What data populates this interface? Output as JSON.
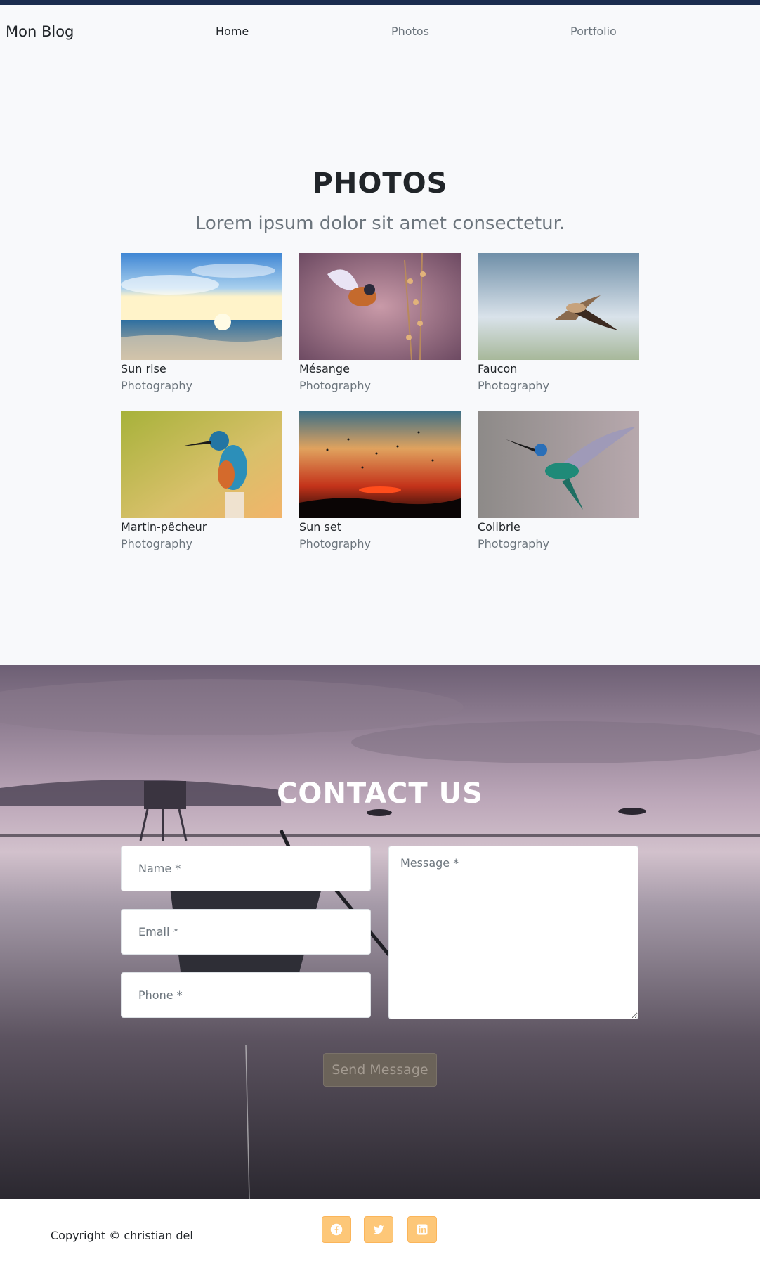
{
  "nav": {
    "brand": "Mon Blog",
    "links": [
      {
        "label": "Home",
        "active": true
      },
      {
        "label": "Photos",
        "active": false
      },
      {
        "label": "Portfolio",
        "active": false
      }
    ]
  },
  "photos": {
    "title": "PHOTOS",
    "subtitle": "Lorem ipsum dolor sit amet consectetur.",
    "items": [
      {
        "title": "Sun rise",
        "category": "Photography"
      },
      {
        "title": "Mésange",
        "category": "Photography"
      },
      {
        "title": "Faucon",
        "category": "Photography"
      },
      {
        "title": "Martin-pêcheur",
        "category": "Photography"
      },
      {
        "title": "Sun set",
        "category": "Photography"
      },
      {
        "title": "Colibrie",
        "category": "Photography"
      }
    ]
  },
  "contact": {
    "title": "CONTACT US",
    "name_placeholder": "Name *",
    "email_placeholder": "Email *",
    "phone_placeholder": "Phone *",
    "message_placeholder": "Message *",
    "send_label": "Send Message"
  },
  "footer": {
    "copyright": "Copyright © christian del",
    "social": [
      "facebook-icon",
      "twitter-icon",
      "linkedin-icon"
    ]
  },
  "colors": {
    "nav_accent": "#1b2d4f",
    "page_bg": "#f8f9fb",
    "social_bg": "#fdc778",
    "muted_text": "#6c757d"
  }
}
